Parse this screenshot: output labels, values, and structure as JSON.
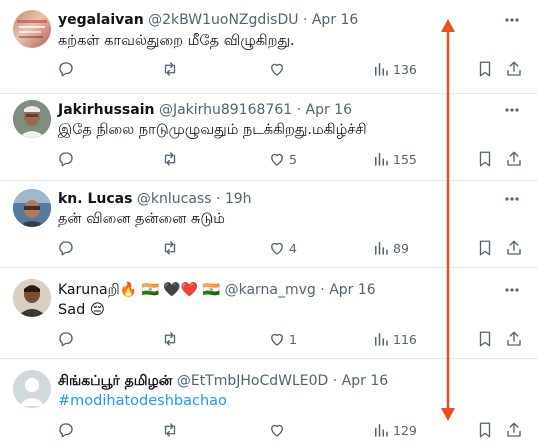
{
  "tweets": [
    {
      "name": "yegalaivan",
      "handle": "@2kBW1uoNZgdisDU",
      "dot": "·",
      "time": "Apr 16",
      "text": "கற்கள் காவல்துறை மீதே விழுகிறது.",
      "reply_count": "",
      "retweet_count": "",
      "like_count": "",
      "view_count": "136"
    },
    {
      "name": "Jakirhussain",
      "handle": "@Jakirhu89168761",
      "dot": "·",
      "time": "Apr 16",
      "text": "இதே நிலை நாடுமுழுவதும் நடக்கிறது.மகிழ்ச்சி",
      "reply_count": "",
      "retweet_count": "",
      "like_count": "5",
      "view_count": "155"
    },
    {
      "name": "kn. Lucas",
      "handle": "@knlucass",
      "dot": "·",
      "time": "19h",
      "text": "தன் வினை தன்னை சுடும்",
      "reply_count": "",
      "retweet_count": "",
      "like_count": "4",
      "view_count": "89"
    },
    {
      "name": "Karunaறி🔥 🇮🇳 🖤❤️ 🇮🇳",
      "handle": "@karna_mvg",
      "dot": "·",
      "time": "Apr 16",
      "text": "Sad 😔",
      "reply_count": "",
      "retweet_count": "",
      "like_count": "1",
      "view_count": "116"
    },
    {
      "name": "சிங்கப்பூர் தமிழன்",
      "handle": "@EtTmbJHoCdWLE0D",
      "dot": "·",
      "time": "Apr 16",
      "text": "#modihatodeshbachao",
      "reply_count": "",
      "retweet_count": "",
      "like_count": "",
      "view_count": "129"
    }
  ],
  "annotation": {
    "color": "#e8501d",
    "icon": "double-headed-arrow"
  },
  "colors": {
    "text": "#0f1419",
    "muted": "#536471",
    "link": "#1d9bf0",
    "border": "#e6e9ec"
  }
}
